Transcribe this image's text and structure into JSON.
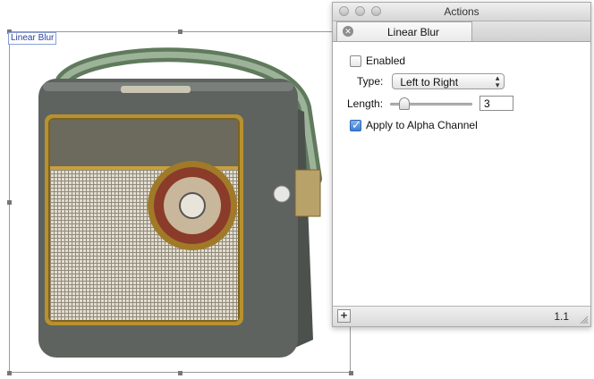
{
  "canvas": {
    "layer_label": "Linear Blur"
  },
  "panel": {
    "window_title": "Actions",
    "tab_label": "Linear Blur",
    "enabled": {
      "label": "Enabled",
      "checked": false
    },
    "type": {
      "label": "Type:",
      "value": "Left to Right"
    },
    "length": {
      "label": "Length:",
      "value": "3",
      "slider_fraction": 0.12
    },
    "alpha": {
      "label": "Apply to Alpha Channel",
      "checked": true
    },
    "footer": {
      "add_label": "+",
      "version": "1.1"
    }
  },
  "icons": {
    "tab_close": "close-icon",
    "select_arrows": "up-down-arrows-icon",
    "add": "plus-icon",
    "resize": "resize-grip-icon"
  },
  "colors": {
    "selection_label_text": "#2a3f9a",
    "checkbox_checked": "#3a7fd8",
    "radio_body": "#5e6360",
    "radio_trim": "#b8912e",
    "radio_handle": "#7d9478"
  }
}
